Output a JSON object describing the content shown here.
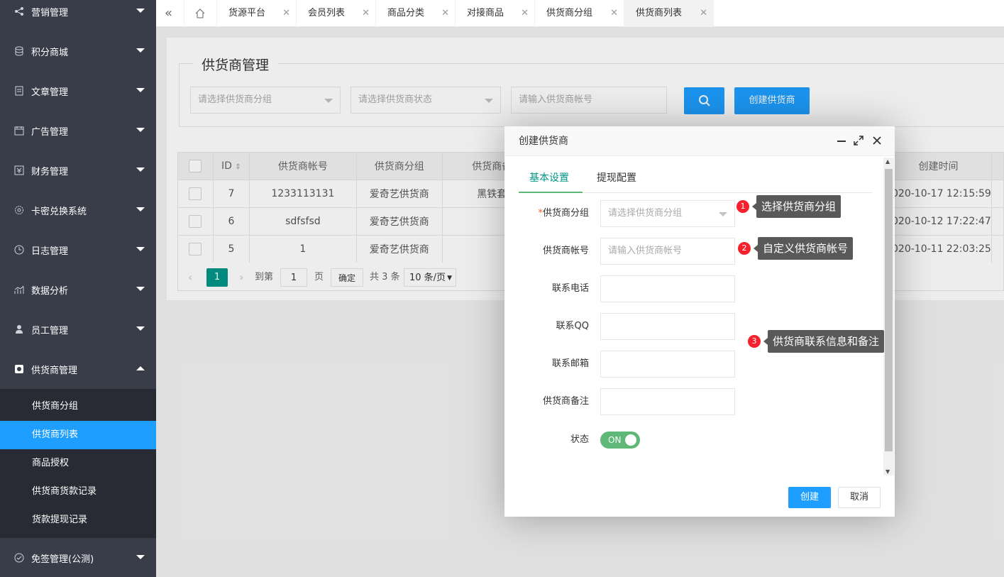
{
  "sidebar": {
    "menus": [
      {
        "label": "营销管理",
        "icon": "share-icon"
      },
      {
        "label": "积分商城",
        "icon": "database-icon"
      },
      {
        "label": "文章管理",
        "icon": "document-icon"
      },
      {
        "label": "广告管理",
        "icon": "calendar-icon"
      },
      {
        "label": "财务管理",
        "icon": "finance-icon"
      },
      {
        "label": "卡密兑换系统",
        "icon": "gear-icon"
      },
      {
        "label": "日志管理",
        "icon": "clock-icon"
      },
      {
        "label": "数据分析",
        "icon": "chart-icon"
      },
      {
        "label": "员工管理",
        "icon": "user-icon"
      },
      {
        "label": "供货商管理",
        "icon": "supplier-icon"
      },
      {
        "label": "免签管理(公测)",
        "icon": "badge-icon"
      }
    ],
    "submenu": [
      "供货商分组",
      "供货商列表",
      "商品授权",
      "供货商货款记录",
      "货款提现记录"
    ],
    "active_sub": "供货商列表"
  },
  "tabs": {
    "items": [
      "货源平台",
      "会员列表",
      "商品分类",
      "对接商品",
      "供货商分组",
      "供货商列表"
    ],
    "active": "供货商列表"
  },
  "search": {
    "legend": "供货商管理",
    "group_placeholder": "请选择供货商分组",
    "status_placeholder": "请选择供货商状态",
    "account_placeholder": "请输入供货商帐号",
    "create_label": "创建供货商"
  },
  "table": {
    "headers": [
      "ID",
      "供货商帐号",
      "供货商分组",
      "供货商备",
      "创建时间"
    ],
    "rows": [
      {
        "id": "7",
        "account": "1233113131",
        "group": "爱奇艺供货商",
        "note": "黑铁套",
        "created": "2020-10-17 12:15:59"
      },
      {
        "id": "6",
        "account": "sdfsfsd",
        "group": "爱奇艺供货商",
        "note": "",
        "created": "2020-10-12 17:22:47"
      },
      {
        "id": "5",
        "account": "1",
        "group": "爱奇艺供货商",
        "note": "",
        "created": "2020-10-11 22:03:25"
      }
    ]
  },
  "pager": {
    "current": "1",
    "goto_label": "到第",
    "goto_value": "1",
    "page_unit": "页",
    "confirm": "确定",
    "total": "共 3 条",
    "size": "10 条/页"
  },
  "dialog": {
    "title": "创建供货商",
    "tabs": [
      "基本设置",
      "提现配置"
    ],
    "fields": {
      "group_label": "供货商分组",
      "group_placeholder": "请选择供货商分组",
      "account_label": "供货商帐号",
      "account_placeholder": "请输入供货商帐号",
      "phone_label": "联系电话",
      "qq_label": "联系QQ",
      "email_label": "联系邮箱",
      "note_label": "供货商备注",
      "status_label": "状态",
      "status_value": "ON"
    },
    "create": "创建",
    "cancel": "取消"
  },
  "annotations": [
    {
      "num": "1",
      "text": "选择供货商分组"
    },
    {
      "num": "2",
      "text": "自定义供货商帐号"
    },
    {
      "num": "3",
      "text": "供货商联系信息和备注"
    }
  ],
  "colors": {
    "sidebar_bg": "#393d49",
    "accent": "#1e9fff",
    "switch": "#5fb878",
    "badge": "#f5222d"
  }
}
